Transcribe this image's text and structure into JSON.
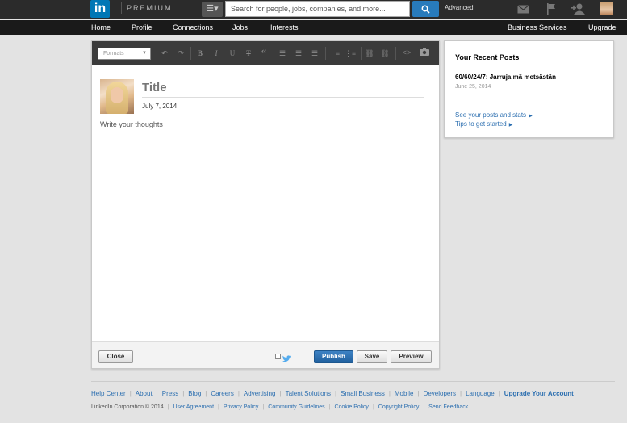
{
  "header": {
    "logo_text": "in",
    "premium_label": "PREMIUM",
    "search_placeholder": "Search for people, jobs, companies, and more...",
    "advanced_label": "Advanced",
    "icons": [
      "menu-icon",
      "search-icon",
      "mail-icon",
      "flag-icon",
      "add-connection-icon",
      "profile-avatar"
    ]
  },
  "nav": {
    "items": [
      "Home",
      "Profile",
      "Connections",
      "Jobs",
      "Interests"
    ],
    "right_items": [
      "Business Services",
      "Upgrade"
    ]
  },
  "editor": {
    "formats_label": "Formats",
    "title_placeholder": "Title",
    "date": "July 7, 2014",
    "body_placeholder": "Write your thoughts",
    "close_label": "Close",
    "publish_label": "Publish",
    "save_label": "Save",
    "preview_label": "Preview",
    "toolbar_icons": [
      "undo-icon",
      "redo-icon",
      "bold-icon",
      "italic-icon",
      "underline-icon",
      "strikethrough-icon",
      "quote-icon",
      "align-left-icon",
      "align-center-icon",
      "align-right-icon",
      "bullet-list-icon",
      "numbered-list-icon",
      "link-icon",
      "unlink-icon",
      "code-icon",
      "camera-icon"
    ]
  },
  "sidebar": {
    "title": "Your Recent Posts",
    "post_title": "60/60/24/7: Jarruja mä metsästän",
    "post_date": "June 25, 2014",
    "link_stats": "See your posts and stats",
    "link_tips": "Tips to get started"
  },
  "footer": {
    "links": [
      "Help Center",
      "About",
      "Press",
      "Blog",
      "Careers",
      "Advertising",
      "Talent Solutions",
      "Small Business",
      "Mobile",
      "Developers",
      "Language"
    ],
    "upgrade_label": "Upgrade Your Account",
    "copyright": "LinkedIn Corporation © 2014",
    "legal_links": [
      "User Agreement",
      "Privacy Policy",
      "Community Guidelines",
      "Cookie Policy",
      "Copyright Policy",
      "Send Feedback"
    ]
  },
  "colors": {
    "brand": "#0077b5",
    "topbar": "#2b2b2b",
    "link": "#2c6fb0",
    "publish": "#2a6aab"
  }
}
